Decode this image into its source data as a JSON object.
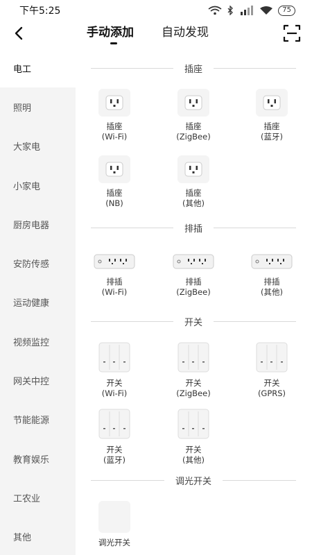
{
  "status_bar": {
    "time": "下午5:25",
    "battery": "75"
  },
  "header": {
    "tabs": [
      {
        "label": "手动添加",
        "active": true
      },
      {
        "label": "自动发现",
        "active": false
      }
    ]
  },
  "sidebar": {
    "items": [
      {
        "label": "电工",
        "active": true
      },
      {
        "label": "照明"
      },
      {
        "label": "大家电"
      },
      {
        "label": "小家电"
      },
      {
        "label": "厨房电器"
      },
      {
        "label": "安防传感"
      },
      {
        "label": "运动健康"
      },
      {
        "label": "视频监控"
      },
      {
        "label": "网关中控"
      },
      {
        "label": "节能能源"
      },
      {
        "label": "教育娱乐"
      },
      {
        "label": "工农业"
      },
      {
        "label": "其他"
      }
    ]
  },
  "sections": [
    {
      "title": "插座",
      "icon": "socket-icon",
      "devices": [
        {
          "line1": "插座",
          "line2": "(Wi-Fi)"
        },
        {
          "line1": "插座",
          "line2": "(ZigBee)"
        },
        {
          "line1": "插座",
          "line2": "(蓝牙)"
        },
        {
          "line1": "插座",
          "line2": "(NB)"
        },
        {
          "line1": "插座",
          "line2": "(其他)"
        }
      ]
    },
    {
      "title": "排插",
      "icon": "power-strip-icon",
      "devices": [
        {
          "line1": "排插",
          "line2": "(Wi-Fi)"
        },
        {
          "line1": "排插",
          "line2": "(ZigBee)"
        },
        {
          "line1": "排插",
          "line2": "(其他)"
        }
      ]
    },
    {
      "title": "开关",
      "icon": "wall-switch-icon",
      "devices": [
        {
          "line1": "开关",
          "line2": "(Wi-Fi)"
        },
        {
          "line1": "开关",
          "line2": "(ZigBee)"
        },
        {
          "line1": "开关",
          "line2": "(GPRS)"
        },
        {
          "line1": "开关",
          "line2": "(蓝牙)"
        },
        {
          "line1": "开关",
          "line2": "(其他)"
        }
      ]
    },
    {
      "title": "调光开关",
      "icon": "dimmer-icon",
      "devices": [
        {
          "line1": "调光开关",
          "line2": ""
        }
      ]
    }
  ]
}
